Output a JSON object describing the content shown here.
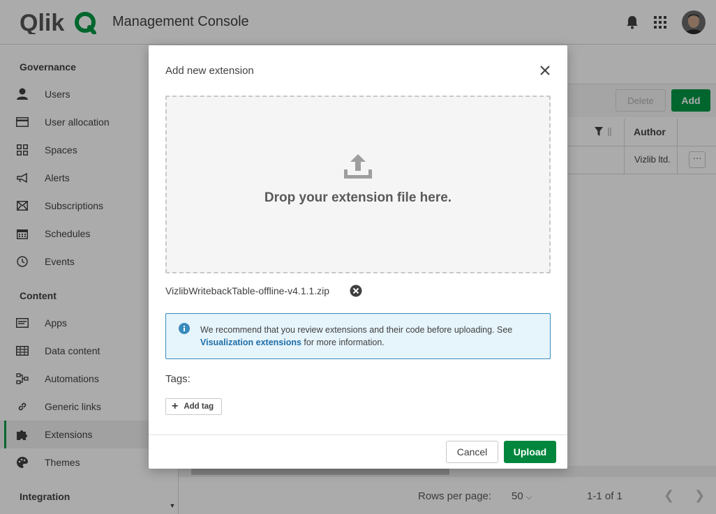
{
  "header": {
    "app_title": "Management Console",
    "logo_text": "Qlik",
    "icons": [
      "bell-icon",
      "apps-grid-icon"
    ]
  },
  "sidebar": {
    "sections": [
      {
        "title": "Governance"
      },
      {
        "title": "Content"
      },
      {
        "title": "Integration"
      }
    ],
    "items": [
      {
        "label": "Users",
        "icon": "user-icon"
      },
      {
        "label": "User allocation",
        "icon": "card-icon"
      },
      {
        "label": "Spaces",
        "icon": "spaces-grid-icon"
      },
      {
        "label": "Alerts",
        "icon": "megaphone-icon"
      },
      {
        "label": "Subscriptions",
        "icon": "envelope-icon"
      },
      {
        "label": "Schedules",
        "icon": "calendar-icon"
      },
      {
        "label": "Events",
        "icon": "clock-icon"
      },
      {
        "label": "Apps",
        "icon": "app-icon"
      },
      {
        "label": "Data content",
        "icon": "table-icon"
      },
      {
        "label": "Automations",
        "icon": "automation-icon"
      },
      {
        "label": "Generic links",
        "icon": "link-icon"
      },
      {
        "label": "Extensions",
        "icon": "puzzle-icon",
        "active": true
      },
      {
        "label": "Themes",
        "icon": "palette-icon"
      }
    ]
  },
  "main": {
    "delete_label": "Delete",
    "add_label": "Add",
    "column_author": "Author",
    "row_author": "Vizlib ltd.",
    "row_menu": "···",
    "rows_per_page_label": "Rows per page:",
    "rows_per_page_value": "50",
    "page_count": "1-1 of 1"
  },
  "modal": {
    "title": "Add new extension",
    "drop_text": "Drop your extension file here.",
    "file_name": "VizlibWritebackTable-offline-v4.1.1.zip",
    "info_text_before": "We recommend that you review extensions and their code before uploading. See ",
    "info_link": "Visualization extensions",
    "info_text_after": " for more information.",
    "tags_label": "Tags:",
    "add_tag_label": "Add tag",
    "cancel_label": "Cancel",
    "upload_label": "Upload"
  },
  "colors": {
    "brand_green": "#009845",
    "upload_green": "#00873d",
    "info_border": "#3a8bbd",
    "info_bg": "#e6f4fb",
    "link": "#1e6ea8"
  }
}
